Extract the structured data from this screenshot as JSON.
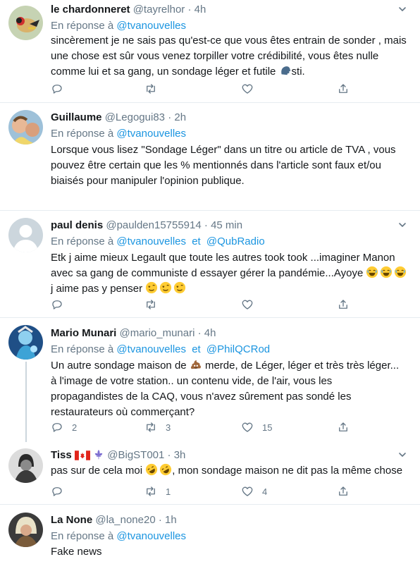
{
  "reply_prefix": "En réponse à",
  "and_word": "et",
  "tweets": [
    {
      "name": "le chardonneret",
      "handle": "@tayrelhor",
      "dot": "·",
      "time": "4h",
      "mentions": [
        "@tvanouvelles"
      ],
      "text_a": "sincèrement je ne sais pas qu'est-ce que vous êtes entrain de sonder , mais une chose est sûr vous venez torpiller votre crédibilité, vous êtes nulle comme lui et sa gang, un sondage léger et futile ",
      "text_b": "sti.",
      "counts": {
        "reply": "",
        "retweet": "",
        "like": ""
      }
    },
    {
      "name": "Guillaume",
      "handle": "@Legogui83",
      "dot": "·",
      "time": "2h",
      "mentions": [
        "@tvanouvelles"
      ],
      "text_a": "Lorsque vous lisez \"Sondage Léger\" dans un titre ou article de TVA , vous pouvez être certain que les % mentionnés dans l'article sont faux et/ou biaisés pour manipuler l'opinion publique.",
      "counts": {
        "reply": "",
        "retweet": "",
        "like": ""
      }
    },
    {
      "name": "paul denis",
      "handle": "@paulden15755914",
      "dot": "·",
      "time": "45 min",
      "mentions": [
        "@tvanouvelles",
        "@QubRadio"
      ],
      "text_a": "Etk j aime mieux Legault que toute les autres took took ...imaginer Manon avec sa gang de communiste d essayer gérer la pandémie...Ayoye ",
      "text_b": " j aime pas y penser ",
      "counts": {
        "reply": "",
        "retweet": "",
        "like": ""
      }
    },
    {
      "name": "Mario Munari",
      "handle": "@mario_munari",
      "dot": "·",
      "time": "4h",
      "mentions": [
        "@tvanouvelles",
        "@PhilQCRod"
      ],
      "text_a": "Un autre sondage maison de ",
      "text_b": " merde, de Léger, léger et très très léger... à l'image de votre station.. un contenu vide, de l'air, vous les propagandistes de la CAQ, vous n'avez sûrement pas sondé les restaurateurs où commerçant?",
      "counts": {
        "reply": "2",
        "retweet": "3",
        "like": "15"
      }
    },
    {
      "name": "Tiss",
      "handle": "@BigST001",
      "dot": "·",
      "time": "3h",
      "text_a": "pas sur de cela moi ",
      "text_b": ", mon sondage maison ne dit pas la même chose",
      "counts": {
        "reply": "",
        "retweet": "1",
        "like": "4"
      }
    },
    {
      "name": "La None",
      "handle": "@la_none20",
      "dot": "·",
      "time": "1h",
      "mentions": [
        "@tvanouvelles"
      ],
      "text_a": "Fake news"
    }
  ],
  "colors": {
    "link": "#1b95e0",
    "muted": "#657786",
    "divider": "#e6ecf0",
    "thread_line": "#ccd6dd"
  },
  "icons": [
    "reply-icon",
    "retweet-icon",
    "like-icon",
    "share-icon",
    "caret-down-icon"
  ]
}
